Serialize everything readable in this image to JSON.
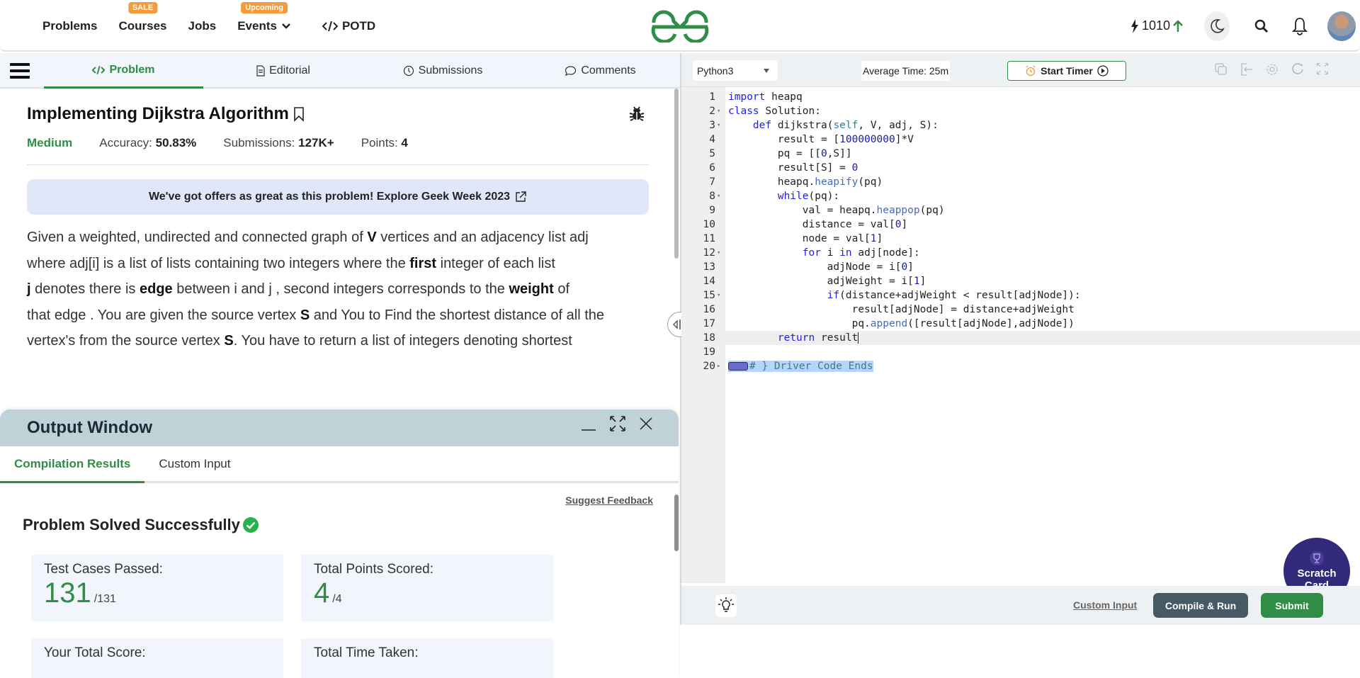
{
  "nav": {
    "items": [
      {
        "label": "Problems",
        "badge": null
      },
      {
        "label": "Courses",
        "badge": "SALE"
      },
      {
        "label": "Jobs",
        "badge": null
      },
      {
        "label": "Events",
        "badge": "Upcoming"
      },
      {
        "label": "POTD",
        "badge": null
      }
    ],
    "streak": "1010",
    "brand_color": "#2f8d46"
  },
  "problem_tabs": [
    "Problem",
    "Editorial",
    "Submissions",
    "Comments"
  ],
  "problem": {
    "title": "Implementing Dijkstra Algorithm",
    "difficulty": "Medium",
    "accuracy_label": "Accuracy:",
    "accuracy": "50.83%",
    "submissions_label": "Submissions:",
    "submissions": "127K+",
    "points_label": "Points:",
    "points": "4",
    "offer": "We've got offers as great as this problem! Explore Geek Week 2023",
    "description": [
      [
        "Given a weighted, undirected and connected graph of ",
        {
          "b": "V"
        },
        " vertices and an adjacency list adj"
      ],
      [
        "where adj[i] is a list of lists containing two integers where the ",
        {
          "b": "first"
        },
        " integer of each list"
      ],
      [
        {
          "b": "j"
        },
        " denotes there is ",
        {
          "b": "edge"
        },
        " between i and j , second integers corresponds to the ",
        {
          "b": "weight"
        },
        " of"
      ],
      [
        "that  edge . You are given the source vertex ",
        {
          "b": "S"
        },
        " and You to Find the shortest distance of all the"
      ],
      [
        "vertex's from the source vertex ",
        {
          "b": "S"
        },
        ". You have to return a list of integers denoting shortest"
      ]
    ]
  },
  "output": {
    "title": "Output Window",
    "tabs": [
      "Compilation Results",
      "Custom Input"
    ],
    "feedback": "Suggest Feedback",
    "status": "Problem Solved Successfully",
    "cards": [
      {
        "label": "Test Cases Passed:",
        "value": "131",
        "total": "/131"
      },
      {
        "label": "Total Points Scored:",
        "value": "4",
        "total": "/4"
      },
      {
        "label": "Your Total Score:",
        "value": "",
        "total": ""
      },
      {
        "label": "Total Time Taken:",
        "value": "",
        "total": ""
      }
    ]
  },
  "editor": {
    "language": "Python3",
    "average_time": "Average Time: 25m",
    "timer": "Start Timer",
    "lines": [
      {
        "n": "1",
        "fold": false,
        "html": "<span class='kw'>import</span> heapq"
      },
      {
        "n": "2",
        "fold": true,
        "html": "<span class='kw'>class</span> Solution:"
      },
      {
        "n": "3",
        "fold": true,
        "html": "    <span class='kw'>def</span> dijkstra(<span class='slf'>self</span>, V, adj, S):"
      },
      {
        "n": "4",
        "fold": false,
        "html": "        result = [<span class='num'>100000000</span>]*V"
      },
      {
        "n": "5",
        "fold": false,
        "html": "        pq = [[<span class='num'>0</span>,S]]"
      },
      {
        "n": "6",
        "fold": false,
        "html": "        result[S] = <span class='num'>0</span>"
      },
      {
        "n": "7",
        "fold": false,
        "html": "        heapq.<span class='fn'>heapify</span>(pq)"
      },
      {
        "n": "8",
        "fold": true,
        "html": "        <span class='kw'>while</span>(pq):"
      },
      {
        "n": "9",
        "fold": false,
        "html": "            val = heapq.<span class='fn'>heappop</span>(pq)"
      },
      {
        "n": "10",
        "fold": false,
        "html": "            distance = val[<span class='num'>0</span>]"
      },
      {
        "n": "11",
        "fold": false,
        "html": "            node = val[<span class='num'>1</span>]"
      },
      {
        "n": "12",
        "fold": true,
        "html": "            <span class='kw'>for</span> i <span class='kw'>in</span> adj[node]:"
      },
      {
        "n": "13",
        "fold": false,
        "html": "                adjNode = i[<span class='num'>0</span>]"
      },
      {
        "n": "14",
        "fold": false,
        "html": "                adjWeight = i[<span class='num'>1</span>]"
      },
      {
        "n": "15",
        "fold": true,
        "html": "                <span class='kw'>if</span>(distance+adjWeight &lt; result[adjNode]):"
      },
      {
        "n": "16",
        "fold": false,
        "html": "                    result[adjNode] = distance+adjWeight"
      },
      {
        "n": "17",
        "fold": false,
        "html": "                    pq.<span class='fn'>append</span>([result[adjNode],adjNode])"
      },
      {
        "n": "18",
        "fold": false,
        "current": true,
        "html": "        <span class='kw'>return</span> result<span class='cursor'></span>"
      },
      {
        "n": "19",
        "fold": false,
        "html": ""
      },
      {
        "n": "20",
        "fold": "closed",
        "html": "<span class='sel'><span class='foldmark'></span><span class='cm'># } Driver Code Ends</span></span>"
      }
    ],
    "custom_input": "Custom Input",
    "compile_run": "Compile & Run",
    "submit": "Submit",
    "scratch_card": "Scratch Card"
  }
}
